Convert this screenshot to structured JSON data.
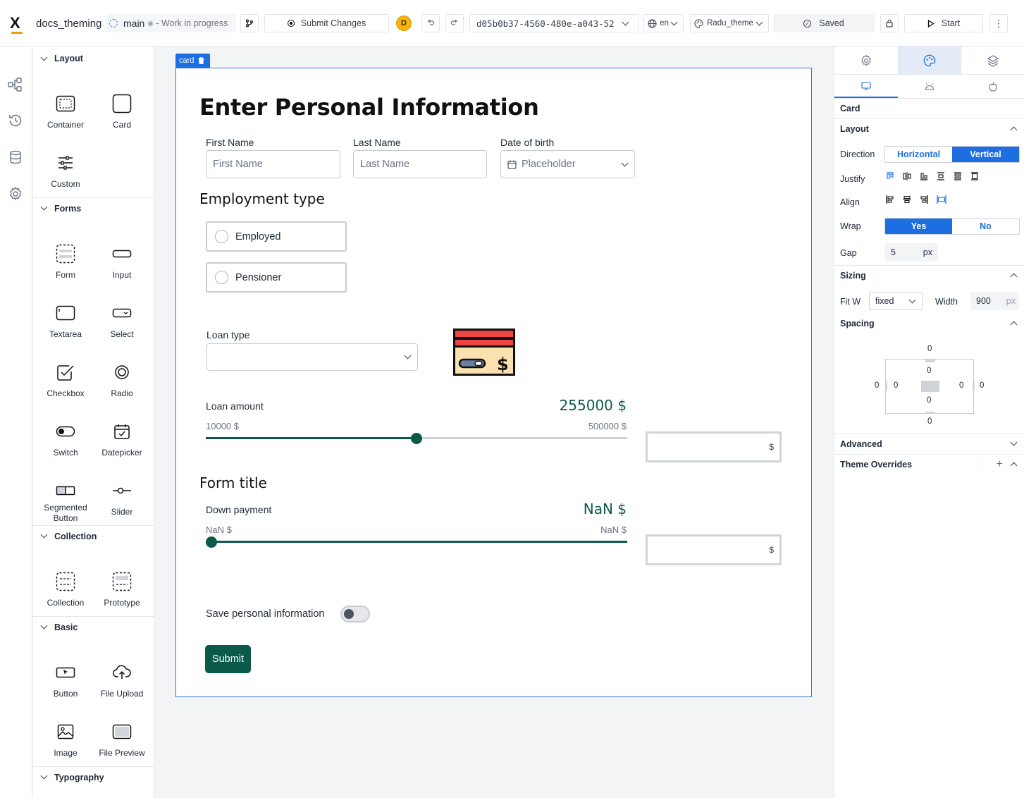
{
  "topbar": {
    "logo": "X",
    "app_title": "docs_theming",
    "branch": "main",
    "branch_status": "- Work in progress",
    "submit_changes": "Submit Changes",
    "avatar_initial": "D",
    "version_id": "d05b0b37-4560-480e-a043-52",
    "language": "en",
    "theme": "Radu_theme",
    "saved": "Saved",
    "start": "Start"
  },
  "panel": {
    "sections": {
      "layout": "Layout",
      "forms": "Forms",
      "collection": "Collection",
      "basic": "Basic",
      "typography": "Typography"
    },
    "components": {
      "container": "Container",
      "card": "Card",
      "custom": "Custom",
      "form": "Form",
      "input": "Input",
      "textarea": "Textarea",
      "select": "Select",
      "checkbox": "Checkbox",
      "radio": "Radio",
      "switch": "Switch",
      "datepicker": "Datepicker",
      "segmented_button": "Segmented Button",
      "slider": "Slider",
      "collection": "Collection",
      "prototype": "Prototype",
      "button": "Button",
      "file_upload": "File Upload",
      "image": "Image",
      "file_preview": "File Preview"
    }
  },
  "canvas": {
    "card_tag": "card",
    "title": "Enter Personal Information",
    "first_name_label": "First Name",
    "first_name_placeholder": "First Name",
    "last_name_label": "Last Name",
    "last_name_placeholder": "Last Name",
    "dob_label": "Date of birth",
    "dob_placeholder": "Placeholder",
    "employment_heading": "Employment type",
    "employment_options": [
      "Employed",
      "Pensioner"
    ],
    "loan_type_label": "Loan type",
    "loan_amount_label": "Loan amount",
    "loan_amount_value": "255000 $",
    "loan_min": "10000 $",
    "loan_max": "500000 $",
    "loan_fraction": 0.5,
    "currency_symbol": "$",
    "form_title": "Form title",
    "down_payment_label": "Down payment",
    "down_payment_value": "NaN $",
    "down_min": "NaN $",
    "down_max": "NaN $",
    "save_info_label": "Save personal information",
    "save_info_on": false,
    "submit": "Submit"
  },
  "rpanel": {
    "element": "Card",
    "layout": "Layout",
    "direction_label": "Direction",
    "direction_options": [
      "Horizontal",
      "Vertical"
    ],
    "direction_selected": "Vertical",
    "justify_label": "Justify",
    "align_label": "Align",
    "wrap_label": "Wrap",
    "wrap_options": [
      "Yes",
      "No"
    ],
    "wrap_selected": "Yes",
    "gap_label": "Gap",
    "gap_value": "5",
    "unit_px": "px",
    "sizing": "Sizing",
    "fitw_label": "Fit W",
    "fitw_value": "fixed",
    "width_label": "Width",
    "width_value": "900",
    "spacing": "Spacing",
    "spacing_values": {
      "margin_top": "0",
      "margin_right": "0",
      "margin_bottom": "0",
      "margin_left": "0",
      "padding_top": "0",
      "padding_right": "0",
      "padding_bottom": "0",
      "padding_left": "0"
    },
    "advanced": "Advanced",
    "theme_overrides": "Theme Overrides"
  },
  "colors": {
    "accent": "#1d6ee0",
    "brand_green": "#0a5a4a",
    "avatar": "#f5b50c"
  }
}
